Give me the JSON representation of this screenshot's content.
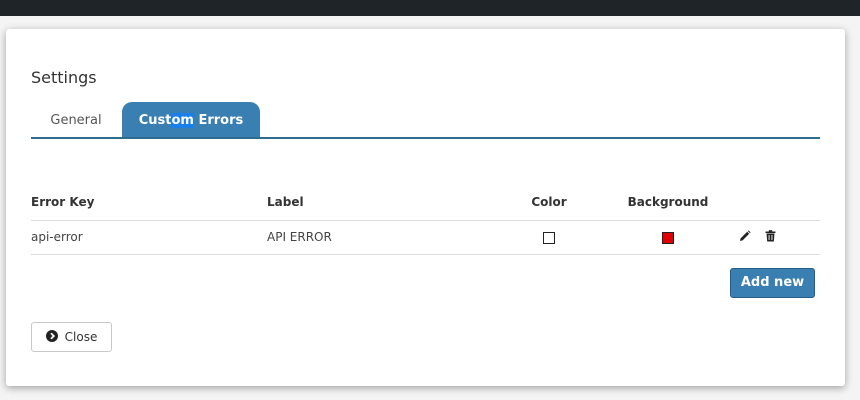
{
  "modal": {
    "title": "Settings"
  },
  "tabs": [
    {
      "label_pre": "Custom",
      "label_post": "Errors",
      "label_mid": ""
    }
  ],
  "tab_general_label": "General",
  "tab_custom": {
    "part1": "Cust",
    "part2": "om",
    "part3": " Errors"
  },
  "table": {
    "headers": {
      "key": "Error Key",
      "label": "Label",
      "color": "Color",
      "background": "Background"
    },
    "rows": [
      {
        "key": "api-error",
        "label": "API ERROR",
        "color": "#ffffff",
        "background": "#e00000"
      }
    ]
  },
  "buttons": {
    "add_new": "Add new",
    "close": "Close"
  },
  "icons": {
    "edit": "pencil-icon",
    "delete": "trash-icon",
    "close": "circle-chevron-right-icon"
  },
  "colors": {
    "accent": "#3a7fb1",
    "topbar": "#1f2428"
  }
}
